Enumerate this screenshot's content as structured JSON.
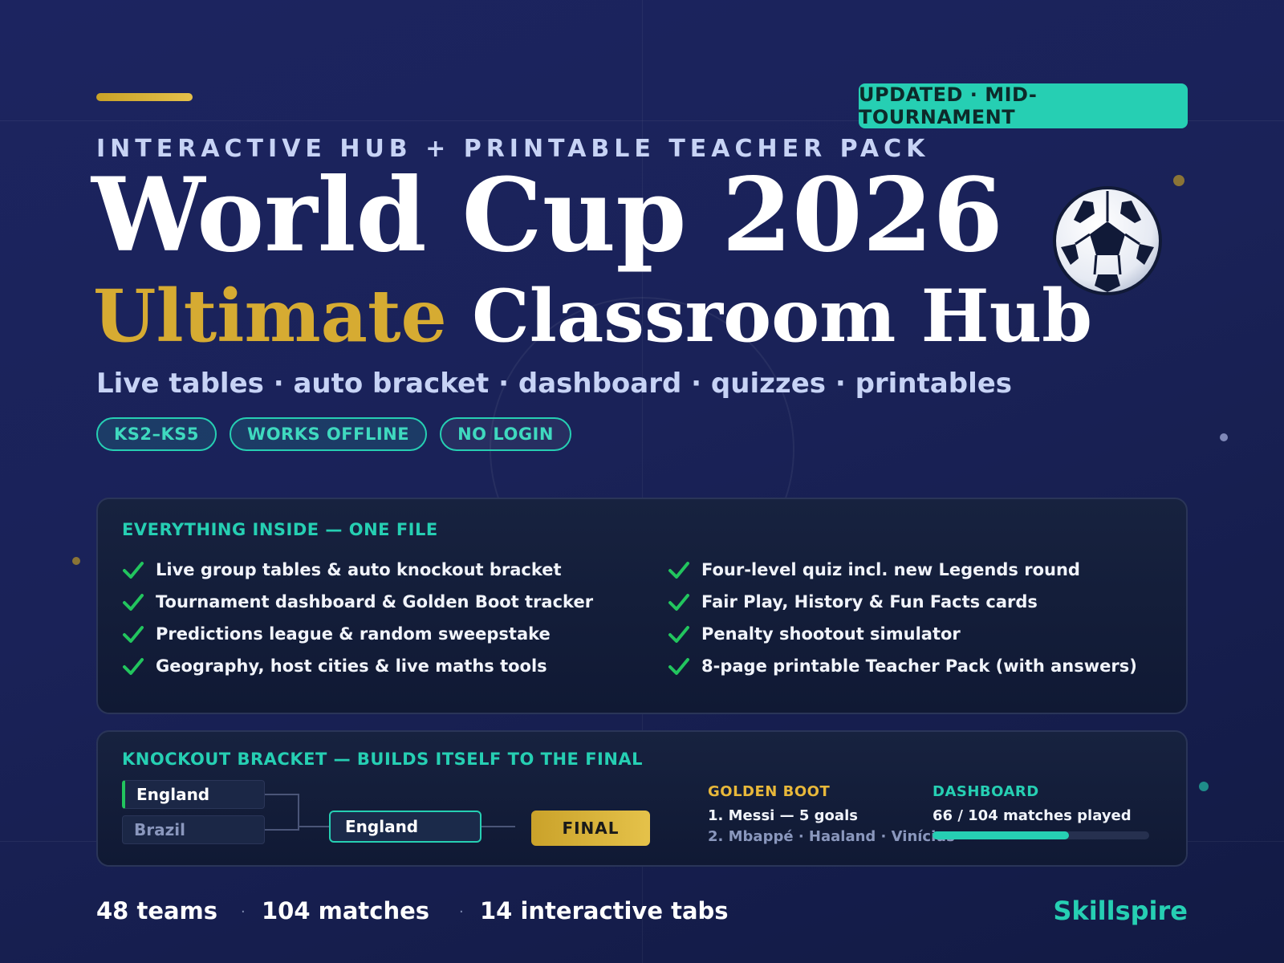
{
  "header": {
    "updated_badge": "UPDATED · MID-TOURNAMENT",
    "eyebrow": "INTERACTIVE HUB + PRINTABLE TEACHER PACK",
    "title_line1": "World Cup 2026",
    "title_line2_highlight": "Ultimate",
    "title_line2_rest": "Classroom Hub",
    "subtitle": "Live tables · auto bracket · dashboard · quizzes · printables",
    "pills": [
      "KS2–KS5",
      "WORKS OFFLINE",
      "NO LOGIN"
    ],
    "ball_icon": "soccer-ball-icon"
  },
  "features_card": {
    "title": "EVERYTHING INSIDE — ONE FILE",
    "left_items": [
      "Live group tables & auto knockout bracket",
      "Tournament dashboard & Golden Boot tracker",
      "Predictions league & random sweepstake",
      "Geography, host cities & live maths tools"
    ],
    "right_items": [
      "Four-level quiz incl. new Legends round",
      "Fair Play, History & Fun Facts cards",
      "Penalty shootout simulator",
      "8-page printable Teacher Pack (with answers)"
    ],
    "check_icon": "check-icon"
  },
  "bracket_card": {
    "title": "KNOCKOUT BRACKET — BUILDS ITSELF TO THE FINAL",
    "team_top": "England",
    "team_bottom": "Brazil",
    "advanced_team": "England",
    "final_label": "FINAL",
    "golden_boot": {
      "heading": "GOLDEN BOOT",
      "leader": "1. Messi — 5 goals",
      "others": "2. Mbappé · Haaland · Vinícius"
    },
    "dashboard": {
      "heading": "DASHBOARD",
      "matches_text": "66 / 104 matches played",
      "progress_fraction": 0.63
    }
  },
  "footer": {
    "stats": [
      "48 teams",
      "104 matches",
      "14 interactive tabs"
    ],
    "separator": "·",
    "brand": "Skillspire"
  },
  "colors": {
    "accent_teal": "#26cfb3",
    "accent_gold": "#d6ab32",
    "check_green": "#22c55e",
    "background": "#1c2460"
  }
}
